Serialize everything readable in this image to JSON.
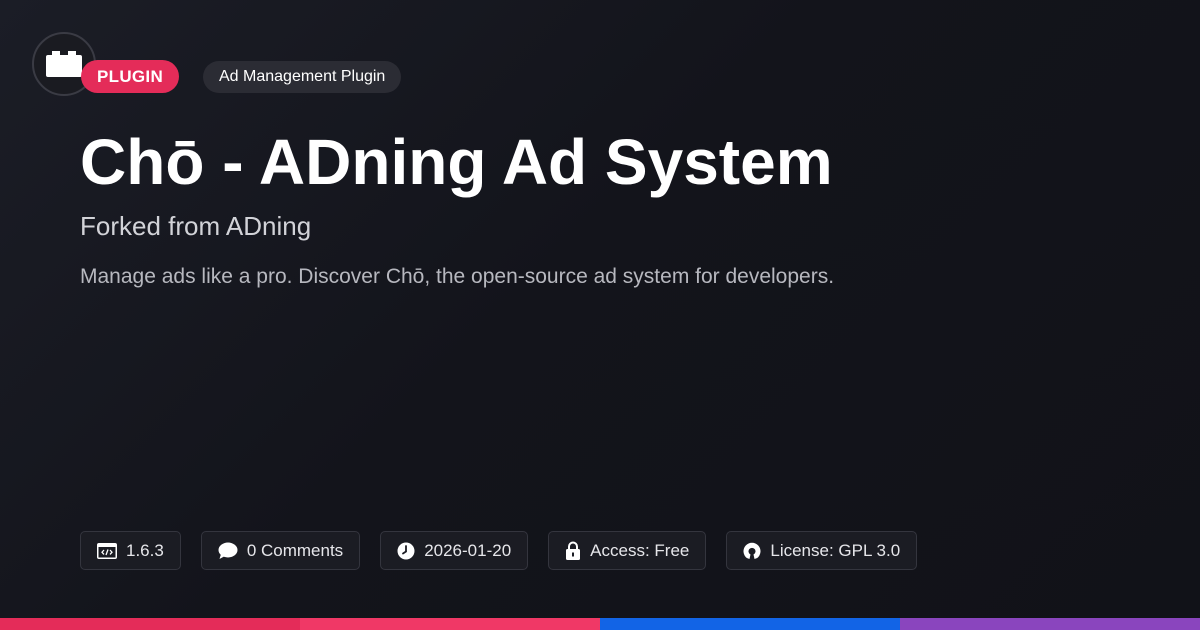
{
  "logo": {
    "icon": "brick-icon"
  },
  "badges": {
    "type": "PLUGIN",
    "category": "Ad Management Plugin"
  },
  "title": "Chō - ADning Ad System",
  "subtitle": "Forked from ADning",
  "description": "Manage ads like a pro. Discover Chō, the open-source ad system for developers.",
  "meta": {
    "version": "1.6.3",
    "comments": "0 Comments",
    "date": "2026-01-20",
    "access": "Access: Free",
    "license": "License: GPL 3.0"
  },
  "colors": {
    "badge": "#e42c59",
    "bar": [
      "#e42c59",
      "#f03866",
      "#1264e6",
      "#8a45be"
    ]
  }
}
